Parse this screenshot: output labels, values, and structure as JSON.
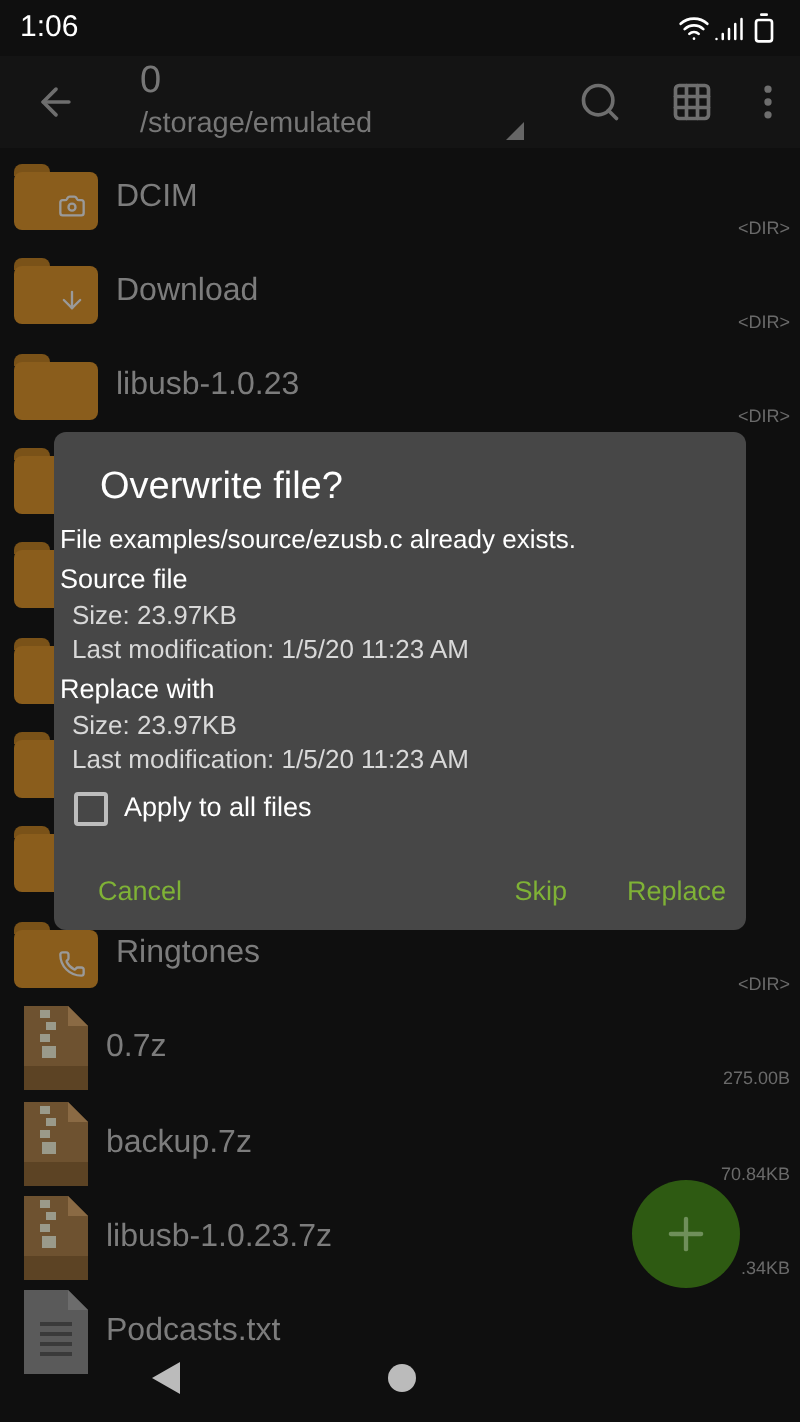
{
  "status_bar": {
    "time": "1:06"
  },
  "toolbar": {
    "title": "0",
    "path": "/storage/emulated"
  },
  "files": [
    {
      "kind": "camera_folder",
      "name": "DCIM",
      "size": "<DIR>"
    },
    {
      "kind": "download_folder",
      "name": "Download",
      "size": "<DIR>"
    },
    {
      "kind": "folder",
      "name": "libusb-1.0.23",
      "size": "<DIR>"
    },
    {
      "kind": "folder_edge"
    },
    {
      "kind": "folder_edge"
    },
    {
      "kind": "folder_edge"
    },
    {
      "kind": "folder_edge"
    },
    {
      "kind": "folder_edge"
    },
    {
      "kind": "phone_folder",
      "name": "Ringtones",
      "size": "<DIR>"
    },
    {
      "kind": "archive",
      "name": "0.7z",
      "size": "275.00B"
    },
    {
      "kind": "archive",
      "name": "backup.7z",
      "size": "70.84KB"
    },
    {
      "kind": "archive",
      "name": "libusb-1.0.23.7z",
      "size": ".34KB"
    },
    {
      "kind": "text",
      "name": "Podcasts.txt"
    }
  ],
  "dialog": {
    "title": "Overwrite file?",
    "message": "File examples/source/ezusb.c already exists.",
    "sections": [
      {
        "heading": "Source file",
        "lines": [
          "Size: 23.97KB",
          "Last modification: 1/5/20 11:23 AM"
        ]
      },
      {
        "heading": "Replace with",
        "lines": [
          "Size: 23.97KB",
          "Last modification: 1/5/20 11:23 AM"
        ]
      }
    ],
    "checkbox": {
      "label": "Apply to all files",
      "checked": false
    },
    "buttons": {
      "left": [
        "Cancel"
      ],
      "right": [
        "Skip",
        "Replace"
      ]
    }
  }
}
